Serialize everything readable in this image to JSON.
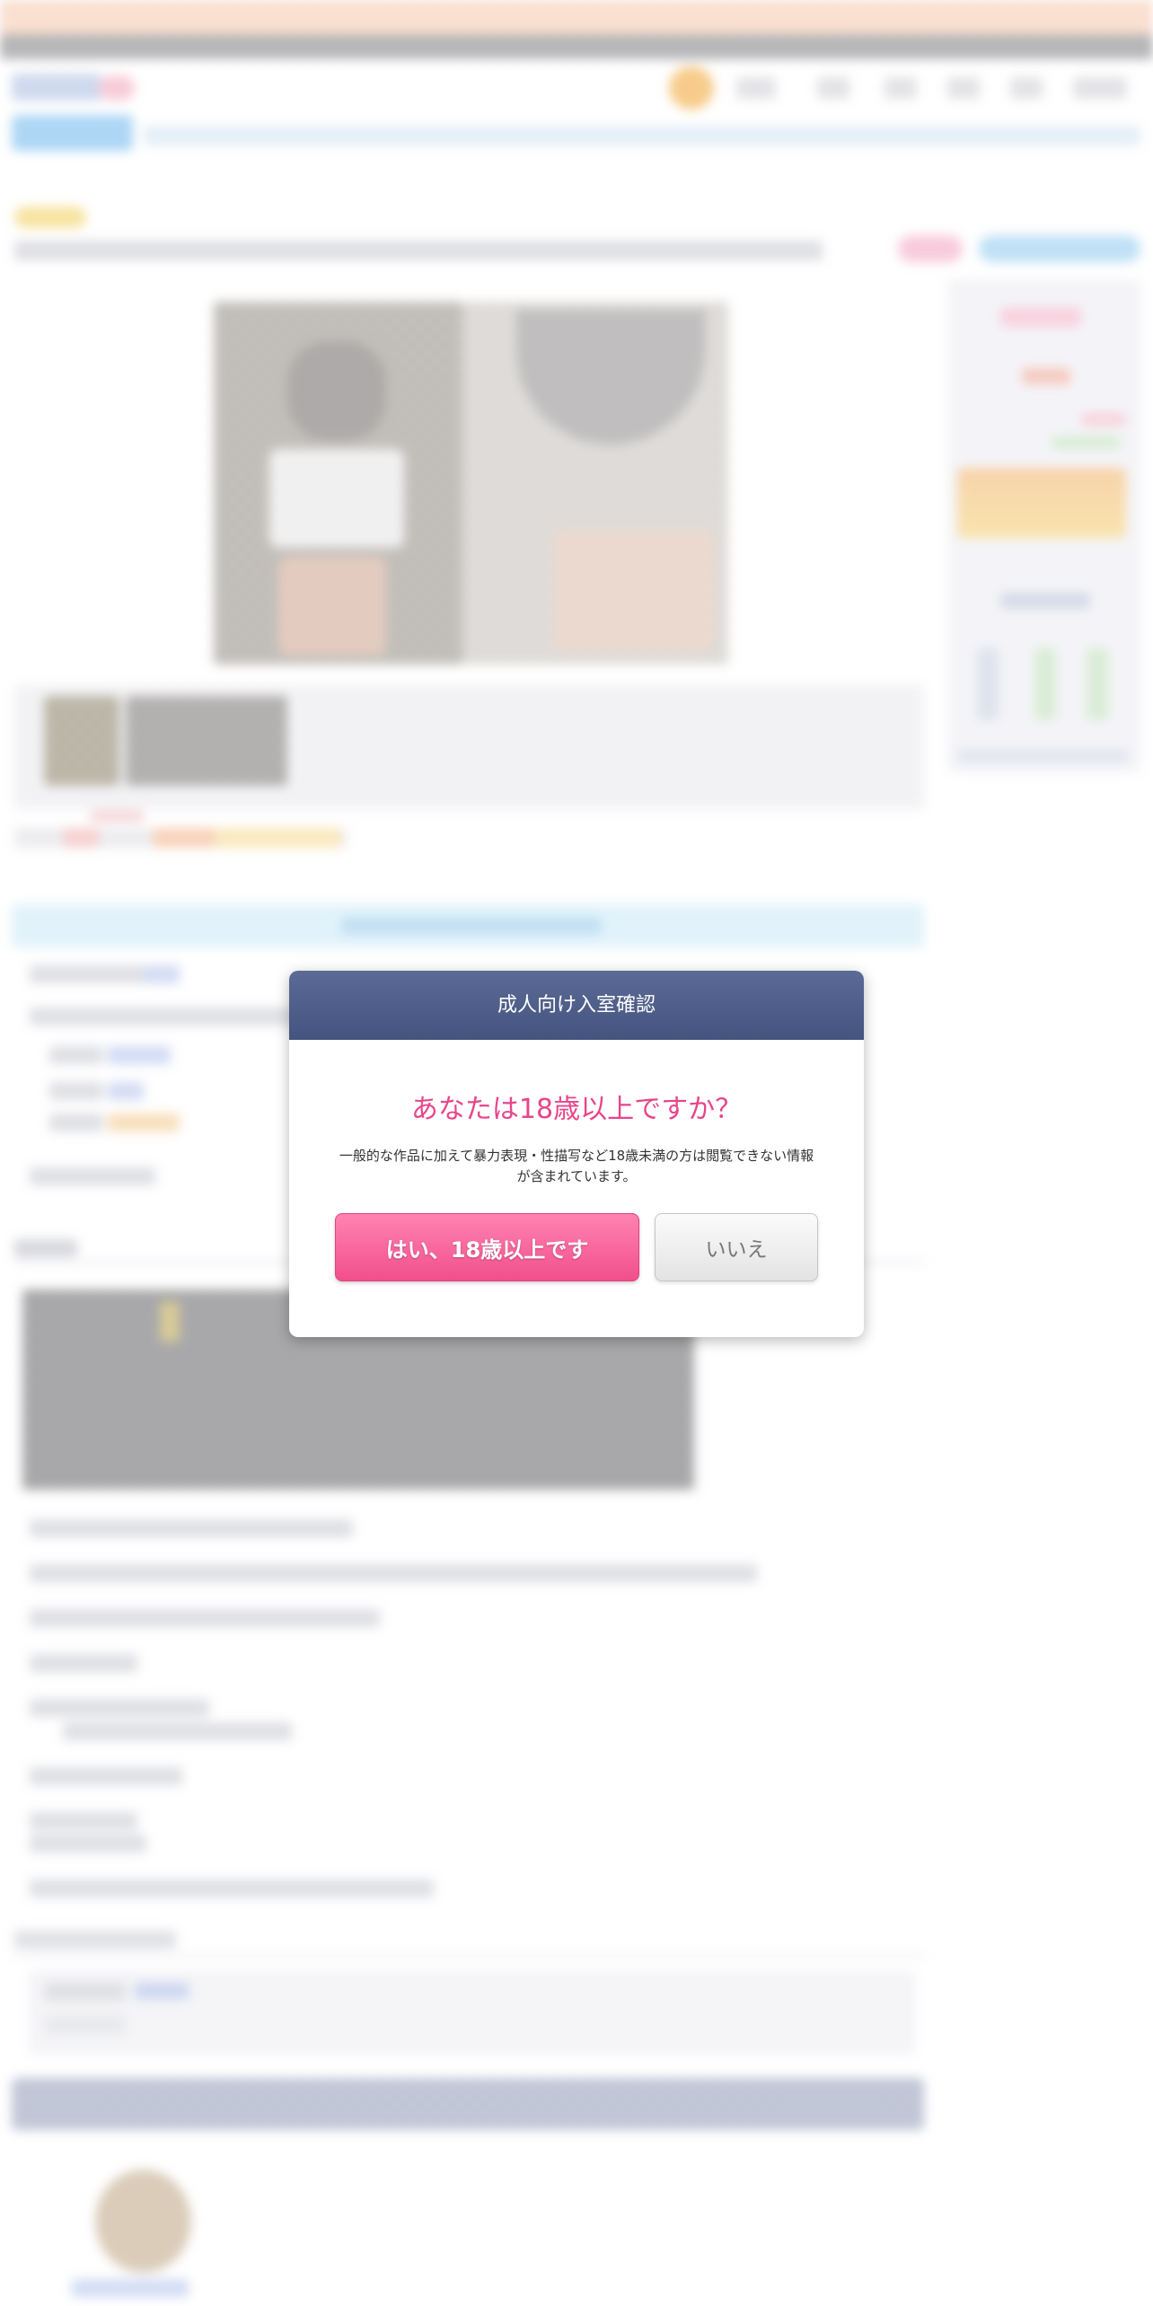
{
  "age_gate": {
    "header_title": "成人向け入室確認",
    "question": "あなたは18歳以上ですか？",
    "description": "一般的な作品に加えて暴力表現・性描写など18歳未満の方は閲覧できない情報が含まれています。",
    "yes_label": "はい、18歳以上です",
    "no_label": "いいえ"
  },
  "colors": {
    "header_bg": "#44547f",
    "question_text": "#e8458a",
    "yes_button": "#f24f8c",
    "no_button": "#e3e3e3"
  }
}
